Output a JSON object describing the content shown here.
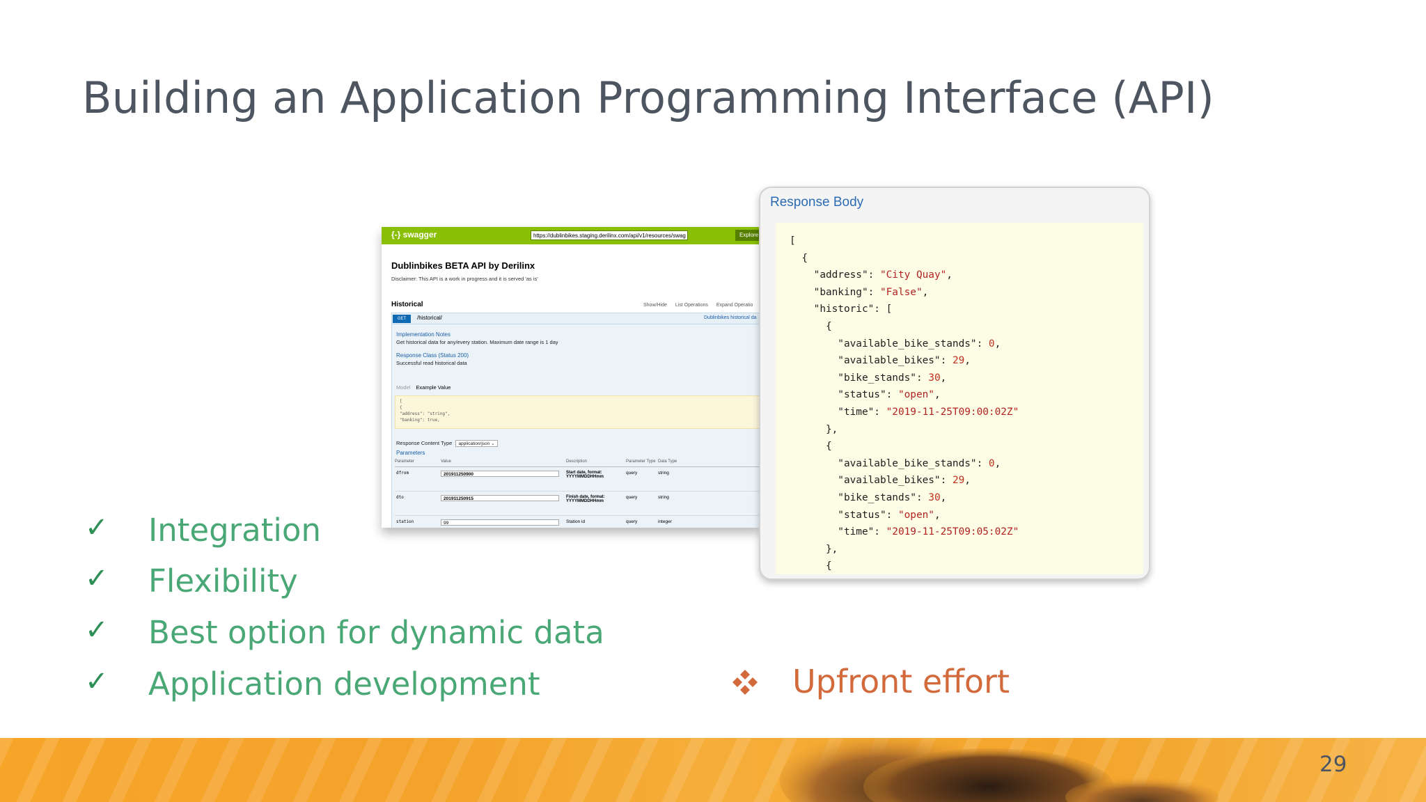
{
  "slide": {
    "title": "Building an Application Programming Interface (API)",
    "page_number": "29"
  },
  "swagger": {
    "logo": "{-} swagger",
    "url": "https://dublinbikes.staging.derilinx.com/api/v1/resources/swag",
    "explore_label": "Explore",
    "api_title": "Dublinbikes BETA API by Derilinx",
    "disclaimer": "Disclaimer: This API is a work in progress and it is served 'as is'",
    "section": "Historical",
    "links": [
      "Show/Hide",
      "List Operations",
      "Expand Operatio"
    ],
    "method": "GET",
    "path": "/historical/",
    "op_summary": "Dublinbikes historical da",
    "impl_notes_title": "Implementation Notes",
    "impl_notes": "Get historical data for any/every station. Maximum date range is 1 day",
    "response_class_title": "Response Class (Status 200)",
    "response_class": "Successful read historical data",
    "model_label": "Model",
    "example_label": "Example Value",
    "example_lines": [
      "[",
      "  {",
      "    \"address\": \"string\",",
      "    \"banking\": true,"
    ],
    "content_type_label": "Response Content Type",
    "content_type_value": "application/json",
    "parameters_title": "Parameters",
    "param_headers": [
      "Parameter",
      "Value",
      "Description",
      "Parameter Type",
      "Data Type"
    ],
    "params": [
      {
        "name": "dfrom",
        "value": "201911250900",
        "description": "Start date, format: YYYYMMDDHHmm",
        "type": "query",
        "data_type": "string"
      },
      {
        "name": "dto",
        "value": "201911250915",
        "description": "Finish date, format: YYYYMMDDHHmm",
        "type": "query",
        "data_type": "string"
      },
      {
        "name": "station",
        "value": "99",
        "description": "Station id",
        "type": "query",
        "data_type": "integer"
      }
    ]
  },
  "response": {
    "title": "Response Body",
    "address": "\"City Quay\"",
    "banking": "\"False\"",
    "records": [
      {
        "available_bike_stands": "0",
        "available_bikes": "29",
        "bike_stands": "30",
        "status": "\"open\"",
        "time": "\"2019-11-25T09:00:02Z\""
      },
      {
        "available_bike_stands": "0",
        "available_bikes": "29",
        "bike_stands": "30",
        "status": "\"open\"",
        "time": "\"2019-11-25T09:05:02Z\""
      }
    ]
  },
  "pros": [
    "Integration",
    "Flexibility",
    "Best option for dynamic data",
    "Application development"
  ],
  "cons": [
    "Upfront effort"
  ],
  "colors": {
    "title": "#4d5560",
    "pros": "#4aa876",
    "cons": "#d36a3c",
    "footer": "#f7a529"
  }
}
